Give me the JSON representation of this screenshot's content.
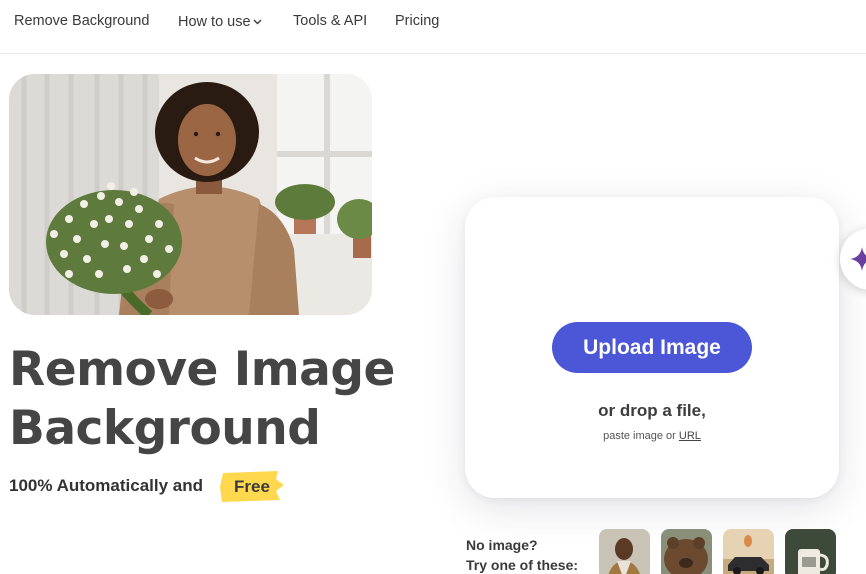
{
  "nav": {
    "items": [
      {
        "label": "Remove Background"
      },
      {
        "label": "How to use"
      },
      {
        "label": "Tools & API"
      },
      {
        "label": "Pricing"
      }
    ]
  },
  "hero": {
    "title_line1": "Remove Image",
    "title_line2": "Background",
    "subtitle": "100% Automatically and",
    "badge": "Free",
    "photo_icon": "woman-with-flowers-photo"
  },
  "upload": {
    "button_label": "Upload Image",
    "drop_text": "or drop a file,",
    "paste_prefix": "paste image or",
    "url_link": "URL"
  },
  "samples": {
    "line1": "No image?",
    "line2": "Try one of these:",
    "thumbnails": [
      "person-sample",
      "bear-sample",
      "car-sample",
      "mug-sample"
    ]
  },
  "fab_icon": "sparkle-icon",
  "colors": {
    "accent": "#4b57d6",
    "badge": "#ffd84d",
    "sparkle": "#6b3fa0"
  }
}
